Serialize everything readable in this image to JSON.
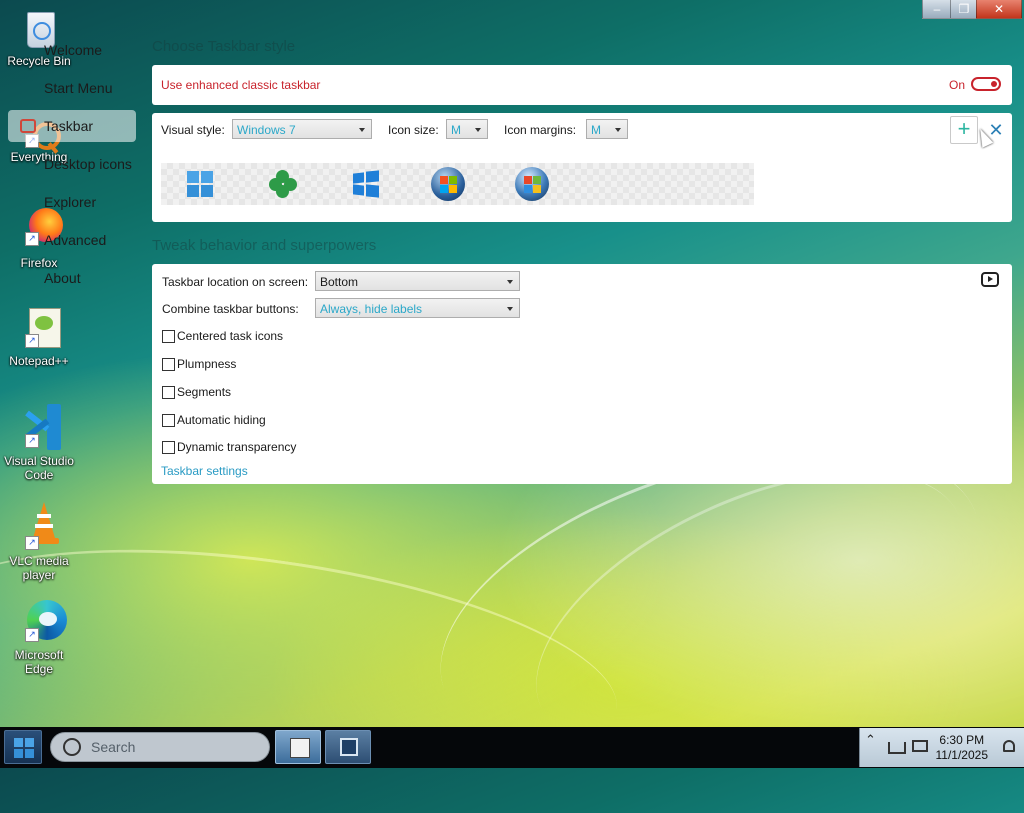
{
  "window_controls": {
    "minimize": "–",
    "restore": "❐",
    "close": "✕"
  },
  "desktop_icons": [
    {
      "label": "Recycle Bin",
      "icon": "recycle-bin-icon"
    },
    {
      "label": "Everything",
      "icon": "everything-icon"
    },
    {
      "label": "Firefox",
      "icon": "firefox-icon"
    },
    {
      "label": "Notepad++",
      "icon": "notepadpp-icon"
    },
    {
      "label": "Visual Studio Code",
      "icon": "vscode-icon"
    },
    {
      "label": "VLC media player",
      "icon": "vlc-icon"
    },
    {
      "label": "Microsoft Edge",
      "icon": "edge-icon"
    }
  ],
  "sidebar": {
    "items": [
      {
        "label": "Welcome"
      },
      {
        "label": "Start Menu"
      },
      {
        "label": "Taskbar",
        "active": true
      },
      {
        "label": "Desktop icons"
      },
      {
        "label": "Explorer"
      },
      {
        "label": "Advanced"
      },
      {
        "label": "About"
      }
    ]
  },
  "main": {
    "section1_title": "Choose Taskbar style",
    "enhanced": {
      "label": "Use enhanced classic taskbar",
      "state": "On"
    },
    "style_row": {
      "visual_style_label": "Visual style:",
      "visual_style_value": "Windows 7",
      "icon_size_label": "Icon size:",
      "icon_size_value": "M",
      "icon_margins_label": "Icon margins:",
      "icon_margins_value": "M",
      "add_symbol": "+",
      "close_symbol": "✕"
    },
    "section2_title": "Tweak behavior and superpowers",
    "behavior": {
      "location_label": "Taskbar location on screen:",
      "location_value": "Bottom",
      "combine_label": "Combine taskbar buttons:",
      "combine_value": "Always, hide labels",
      "options": [
        {
          "label": "Centered task icons",
          "checked": false
        },
        {
          "label": "Plumpness",
          "checked": false
        },
        {
          "label": "Segments",
          "checked": false
        },
        {
          "label": "Automatic hiding",
          "checked": false
        },
        {
          "label": "Dynamic transparency",
          "checked": false
        }
      ],
      "settings_link": "Taskbar settings"
    }
  },
  "taskbar": {
    "search_placeholder": "Search",
    "time": "6:30 PM",
    "date": "11/1/2025"
  }
}
